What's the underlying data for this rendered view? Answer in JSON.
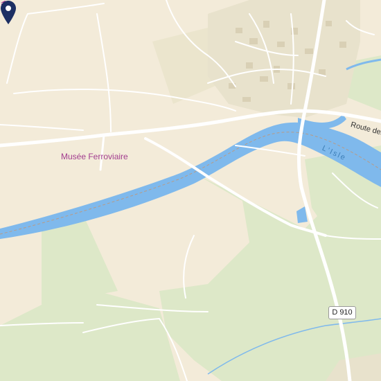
{
  "map": {
    "poi": {
      "label": "Musée Ferroviaire",
      "icon": "museum-icon"
    },
    "road_label": "Route des C",
    "river_label": "L'Isle",
    "road_shield": "D 910",
    "marker": {
      "icon": "map-pin-icon"
    },
    "colors": {
      "land": "#f3ebd9",
      "green": "#dde8c8",
      "urban": "#e8e2cc",
      "water": "#7fb9ec",
      "road": "#ffffff",
      "pin": "#1c2f63",
      "poi": "#a23d8f"
    }
  }
}
